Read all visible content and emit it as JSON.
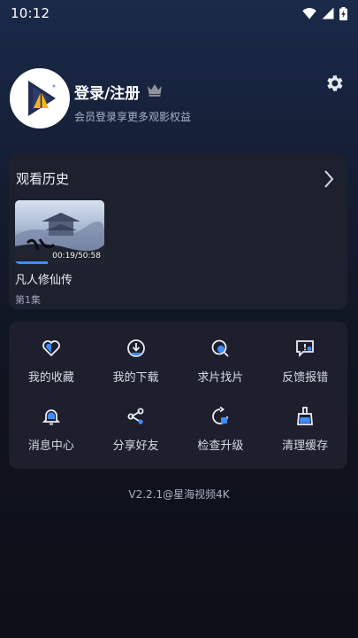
{
  "status_bar": {
    "time": "10:12",
    "icons": [
      "wifi-icon",
      "signal-icon",
      "battery-charging-icon"
    ]
  },
  "profile": {
    "title": "登录/注册",
    "subtitle": "会员登录享更多观影权益",
    "badge_icon": "crown-icon",
    "settings_icon": "gear-icon"
  },
  "history": {
    "heading": "观看历史",
    "items": [
      {
        "title": "凡人修仙传",
        "episode": "第1集",
        "duration": "00:19/50:58",
        "progress": 0.37
      }
    ]
  },
  "menu": {
    "items": [
      {
        "label": "我的收藏",
        "icon": "heart-icon"
      },
      {
        "label": "我的下载",
        "icon": "download-icon"
      },
      {
        "label": "求片找片",
        "icon": "search-film-icon"
      },
      {
        "label": "反馈报错",
        "icon": "feedback-icon"
      },
      {
        "label": "消息中心",
        "icon": "bell-icon"
      },
      {
        "label": "分享好友",
        "icon": "share-icon"
      },
      {
        "label": "检查升级",
        "icon": "upgrade-icon"
      },
      {
        "label": "清理缓存",
        "icon": "broom-icon"
      }
    ]
  },
  "footer": {
    "version": "V2.2.1@星海视频4K"
  },
  "colors": {
    "accent_blue": "#3f8cff",
    "icon_stroke": "#e9edf5",
    "card_bg": "#1e222e"
  }
}
